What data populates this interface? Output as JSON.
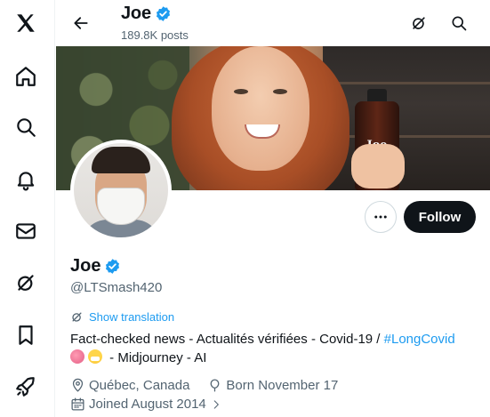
{
  "nav": {
    "items": [
      {
        "icon": "x-logo-icon"
      },
      {
        "icon": "home-icon"
      },
      {
        "icon": "search-icon"
      },
      {
        "icon": "bell-icon"
      },
      {
        "icon": "mail-icon"
      },
      {
        "icon": "grok-icon"
      },
      {
        "icon": "bookmark-icon"
      },
      {
        "icon": "rocket-icon"
      }
    ]
  },
  "header": {
    "name": "Joe",
    "posts": "189.8K posts",
    "icons": [
      "back-arrow-icon",
      "grok-icon",
      "search-icon"
    ]
  },
  "banner": {
    "bottle_label": "Joe"
  },
  "actions": {
    "follow_label": "Follow",
    "more_icon": "more-dots-icon"
  },
  "profile": {
    "name": "Joe",
    "handle": "@LTSmash420",
    "show_translation": "Show translation",
    "bio_line1": "Fact-checked news - Actualités vérifiées - Covid-19 / ",
    "bio_hashtag": "#LongCovid",
    "bio_line2": " - Midjourney - AI",
    "bio_emojis": [
      "brain-emoji",
      "mask-emoji"
    ],
    "location": "Québec, Canada",
    "born": "Born November 17",
    "joined": "Joined August 2014",
    "joined_chevron": ">"
  },
  "colors": {
    "accent": "#1d9bf0",
    "text": "#0f1419",
    "muted": "#536471",
    "follow_bg": "#0f1419",
    "verified": "#1d9bf0"
  }
}
